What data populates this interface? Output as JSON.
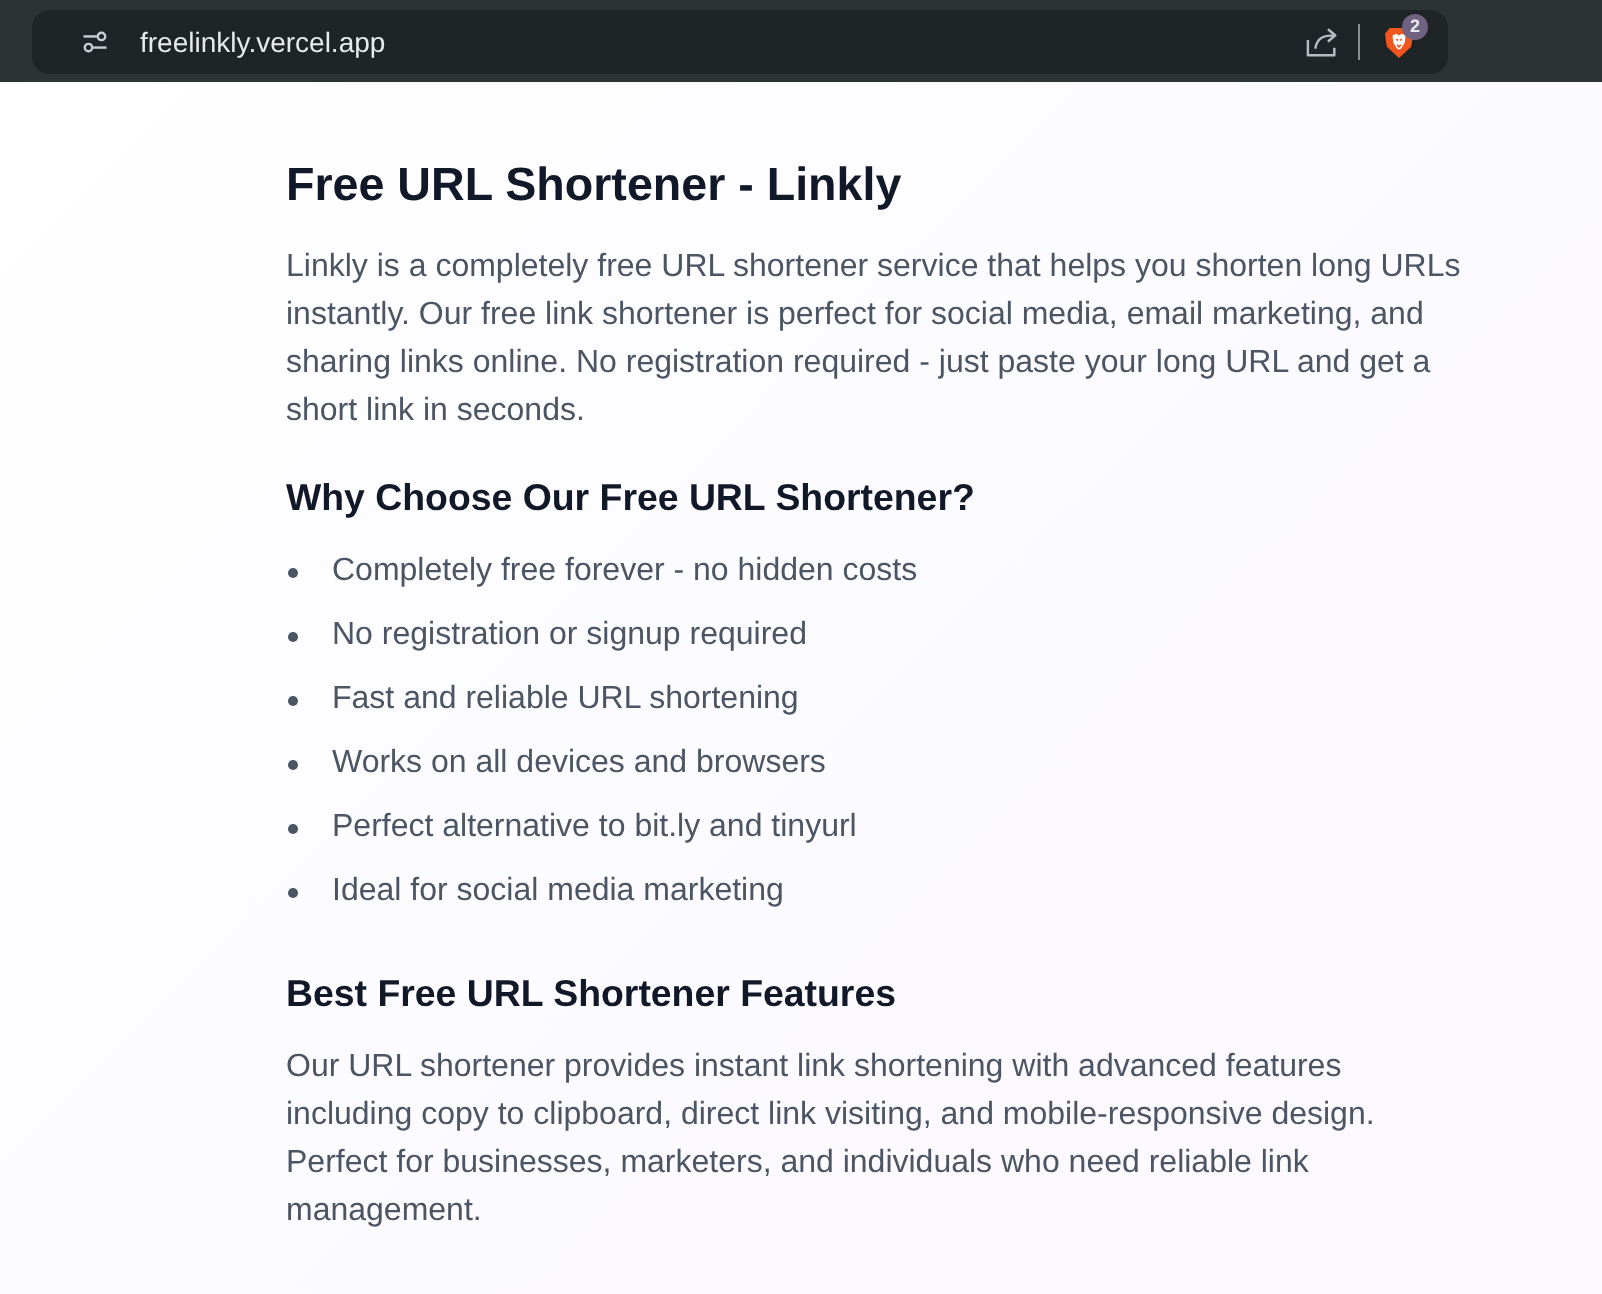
{
  "browser": {
    "url": "freelinkly.vercel.app",
    "shield_count": "2"
  },
  "page": {
    "title": "Free URL Shortener - Linkly",
    "intro": "Linkly is a completely free URL shortener service that helps you shorten long URLs instantly. Our free link shortener is perfect for social media, email marketing, and sharing links online. No registration required - just paste your long URL and get a short link in seconds.",
    "sections": [
      {
        "kind": "list",
        "heading": "Why Choose Our Free URL Shortener?",
        "items": [
          "Completely free forever - no hidden costs",
          "No registration or signup required",
          "Fast and reliable URL shortening",
          "Works on all devices and browsers",
          "Perfect alternative to bit.ly and tinyurl",
          "Ideal for social media marketing"
        ]
      },
      {
        "kind": "paragraph",
        "heading": "Best Free URL Shortener Features",
        "text": "Our URL shortener provides instant link shortening with advanced features including copy to clipboard, direct link visiting, and mobile-responsive design. Perfect for businesses, marketers, and individuals who need reliable link management."
      }
    ]
  }
}
